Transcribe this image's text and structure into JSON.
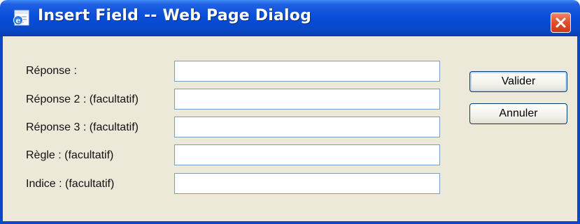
{
  "window": {
    "title": "Insert Field -- Web Page Dialog"
  },
  "form": {
    "fields": [
      {
        "label": "Réponse :",
        "value": ""
      },
      {
        "label": "Réponse 2 : (facultatif)",
        "value": ""
      },
      {
        "label": "Réponse 3 : (facultatif)",
        "value": ""
      },
      {
        "label": "Règle : (facultatif)",
        "value": ""
      },
      {
        "label": "Indice : (facultatif)",
        "value": ""
      }
    ]
  },
  "buttons": {
    "validate_label": "Valider",
    "cancel_label": "Annuler"
  },
  "icons": {
    "app": "ie-page-icon",
    "close": "close-icon"
  },
  "colors": {
    "titlebar": "#0a4fd9",
    "dialog_background": "#ece9d8",
    "close_button": "#e4512d",
    "input_border": "#7f9db9"
  }
}
